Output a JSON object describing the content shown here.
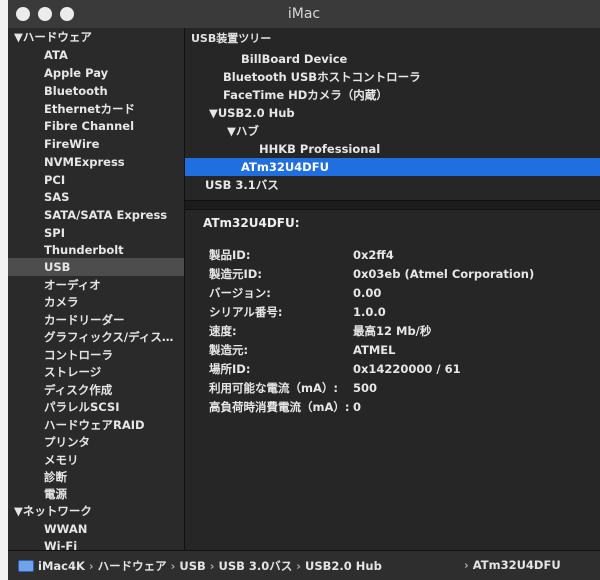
{
  "window": {
    "title": "iMac"
  },
  "sidebar": {
    "group1": "▼ハードウェア",
    "items": [
      "ATA",
      "Apple Pay",
      "Bluetooth",
      "Ethernetカード",
      "Fibre Channel",
      "FireWire",
      "NVMExpress",
      "PCI",
      "SAS",
      "SATA/SATA Express",
      "SPI",
      "Thunderbolt",
      "USB",
      "オーディオ",
      "カメラ",
      "カードリーダー",
      "グラフィックス/ディス…",
      "コントローラ",
      "ストレージ",
      "ディスク作成",
      "パラレルSCSI",
      "ハードウェアRAID",
      "プリンタ",
      "メモリ",
      "診断",
      "電源"
    ],
    "selected_index": 12,
    "group2": "▼ネットワーク",
    "items2": [
      "WWAN",
      "Wi-Fi"
    ]
  },
  "tree": {
    "header": "USB装置ツリー",
    "rows": [
      {
        "label": "BillBoard Device"
      },
      {
        "label": "Bluetooth USBホストコントローラ"
      },
      {
        "label": "FaceTime HDカメラ（内蔵）"
      },
      {
        "label": "▼USB2.0 Hub"
      },
      {
        "label": "▼ハブ"
      },
      {
        "label": "HHKB Professional"
      },
      {
        "label": "ATm32U4DFU"
      },
      {
        "label": "USB 3.1バス"
      }
    ],
    "selected_index": 6
  },
  "detail": {
    "title": "ATm32U4DFU:",
    "rows": [
      {
        "key": "製品ID:",
        "value": "0x2ff4"
      },
      {
        "key": "製造元ID:",
        "value": "0x03eb  (Atmel Corporation)"
      },
      {
        "key": "バージョン:",
        "value": "0.00"
      },
      {
        "key": "シリアル番号:",
        "value": "1.0.0"
      },
      {
        "key": "速度:",
        "value": "最高12 Mb/秒"
      },
      {
        "key": "製造元:",
        "value": "ATMEL"
      },
      {
        "key": "場所ID:",
        "value": "0x14220000 / 61"
      },
      {
        "key": "利用可能な電流（mA）:",
        "value": "500"
      },
      {
        "key": "高負荷時消費電流（mA）:",
        "value": "0"
      }
    ]
  },
  "pathbar": {
    "icon": "imac-icon",
    "crumbs": [
      "iMac4K",
      "ハードウェア",
      "USB",
      "USB 3.0バス",
      "USB2.0 Hub"
    ],
    "last": "ATm32U4DFU"
  }
}
